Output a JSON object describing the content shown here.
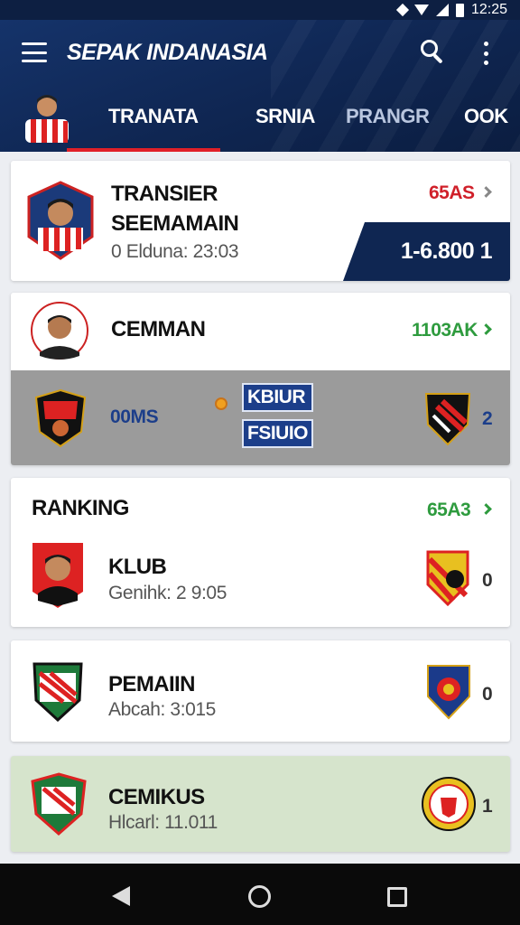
{
  "status_bar": {
    "time": "12:25"
  },
  "header": {
    "title": "SEPAK INDANASIA",
    "tabs": [
      {
        "label": "TRANATA",
        "active": true
      },
      {
        "label": "SRNIA",
        "active": false
      },
      {
        "label": "PRANGR",
        "active": false
      },
      {
        "label": "OOK",
        "active": false
      }
    ]
  },
  "cards": {
    "transfer": {
      "title_line1": "TRANSIER",
      "title_line2": "SEEMAMAIN",
      "subtitle": "0 Elduna: 23:03",
      "tag": "65AS",
      "banner": "1-6.800 1"
    },
    "match": {
      "title": "CEMMAN",
      "tag": "1103AK",
      "home_label": "00MS",
      "mid_top": "KBIUR",
      "mid_bottom": "FSIUIO",
      "away_score": "2"
    },
    "ranking": {
      "section_title": "RANKING",
      "tag": "65A3",
      "title": "KLUB",
      "subtitle": "Genihk: 2 9:05",
      "score": "0"
    },
    "pemain": {
      "title": "PEMAIIN",
      "subtitle": "Abcah: 3:015",
      "score": "0"
    },
    "cemikus": {
      "title": "CEMIKUS",
      "subtitle": "Hlcarl: 11.011",
      "score": "1"
    }
  },
  "colors": {
    "header_bg": "#0f2652",
    "tab_indicator": "#e02028",
    "tag_red": "#d0202a",
    "tag_green": "#2e9b3e",
    "banner_bg": "#0f2652",
    "highlight_card": "#d6e4cc"
  },
  "icons": [
    "menu-icon",
    "search-icon",
    "more-vert-icon",
    "chevron-right-icon",
    "back-icon",
    "home-icon",
    "recents-icon"
  ]
}
